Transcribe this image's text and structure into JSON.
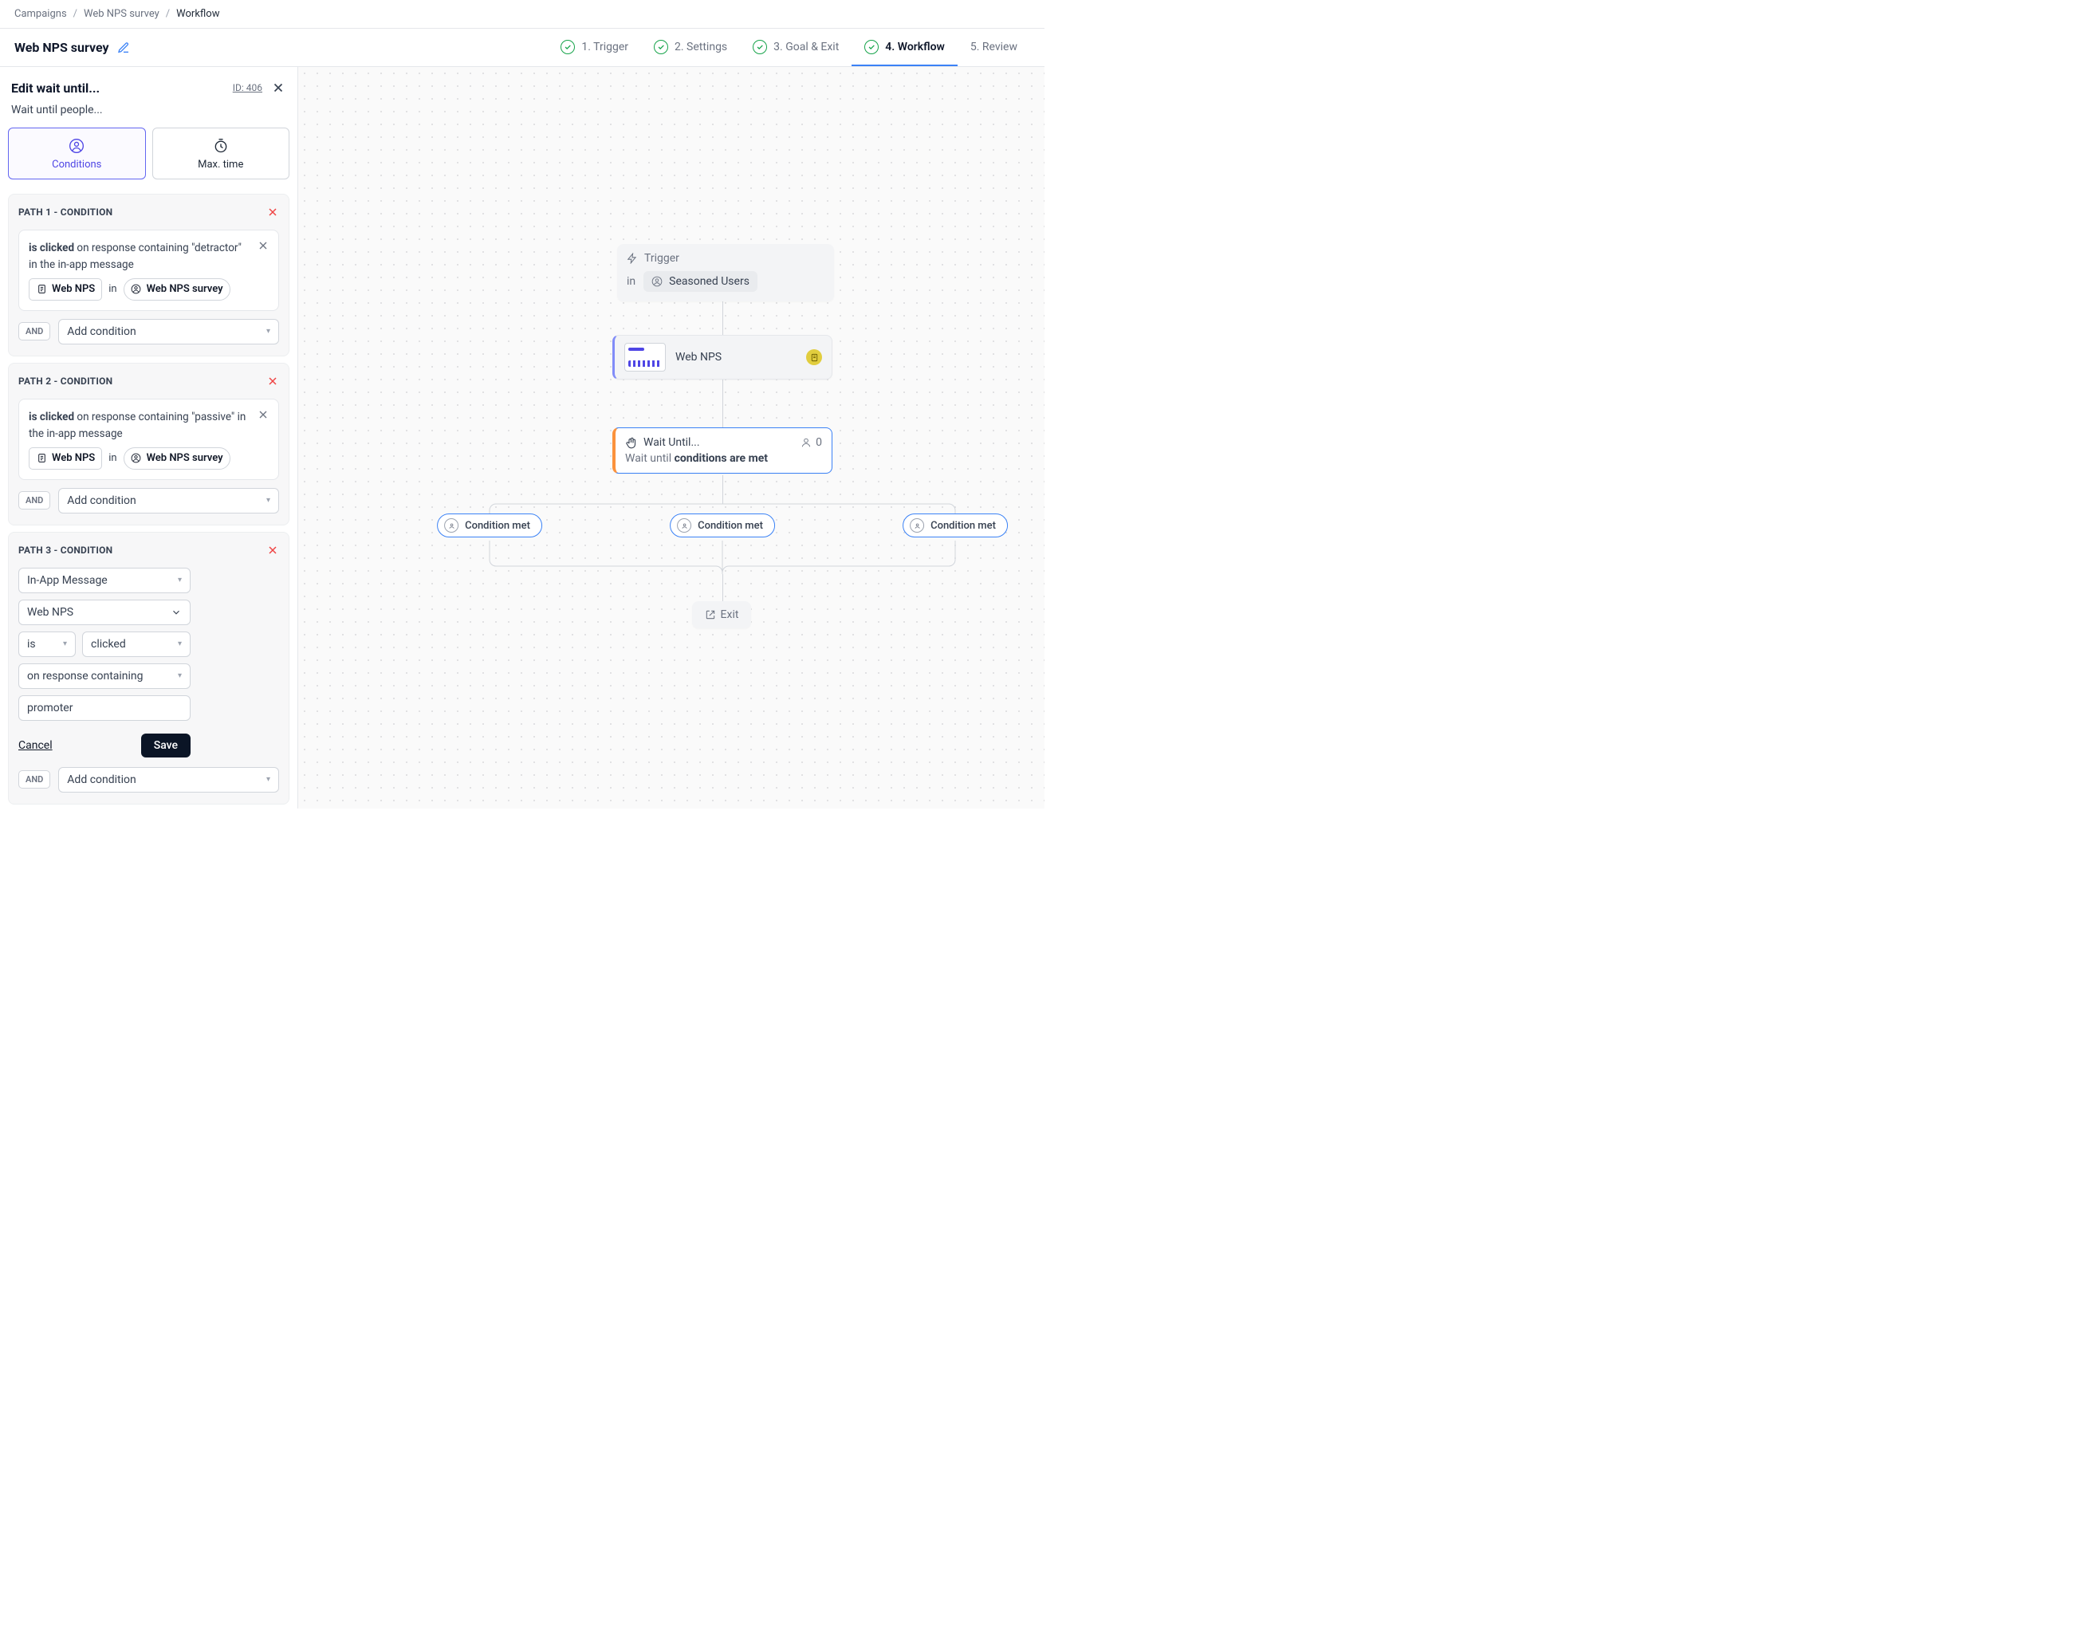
{
  "breadcrumb": {
    "items": [
      "Campaigns",
      "Web NPS survey",
      "Workflow"
    ]
  },
  "header": {
    "title": "Web NPS survey",
    "steps": [
      {
        "label": "1. Trigger",
        "done": true,
        "active": false
      },
      {
        "label": "2. Settings",
        "done": true,
        "active": false
      },
      {
        "label": "3. Goal & Exit",
        "done": true,
        "active": false
      },
      {
        "label": "4. Workflow",
        "done": true,
        "active": true
      },
      {
        "label": "5. Review",
        "done": false,
        "active": false
      }
    ]
  },
  "panel": {
    "title": "Edit wait until...",
    "id_label": "ID: 406",
    "subheading": "Wait until people...",
    "tabs": {
      "conditions": "Conditions",
      "maxtime": "Max. time"
    },
    "paths": [
      {
        "title": "PATH 1 - CONDITION",
        "card": {
          "pre_bold": "is clicked",
          "post": " on response containing \"detractor\" in the in-app message ",
          "chip_msg": "Web NPS",
          "joiner": "in",
          "chip_campaign": "Web NPS survey"
        },
        "and_label": "AND",
        "add_cond": "Add condition"
      },
      {
        "title": "PATH 2 - CONDITION",
        "card": {
          "pre_bold": "is clicked",
          "post": " on response containing \"passive\" in the in-app message ",
          "chip_msg": "Web NPS",
          "joiner": "in",
          "chip_campaign": "Web NPS survey"
        },
        "and_label": "AND",
        "add_cond": "Add condition"
      }
    ],
    "path3": {
      "title": "PATH 3 - CONDITION",
      "fields": {
        "type": "In-App Message",
        "message": "Web NPS",
        "op1": "is",
        "op2": "clicked",
        "qualifier": "on response containing",
        "value": "promoter"
      },
      "cancel": "Cancel",
      "save": "Save",
      "and_label": "AND",
      "add_cond": "Add condition"
    },
    "outer_add": "Add condition"
  },
  "canvas": {
    "trigger": {
      "label": "Trigger",
      "in": "in",
      "segment": "Seasoned Users"
    },
    "content": {
      "name": "Web NPS"
    },
    "wait": {
      "title": "Wait Until...",
      "count": "0",
      "sub_pre": "Wait until ",
      "sub_bold": "conditions are met"
    },
    "branch": {
      "label": "Condition met"
    },
    "exit": {
      "label": "Exit"
    }
  }
}
